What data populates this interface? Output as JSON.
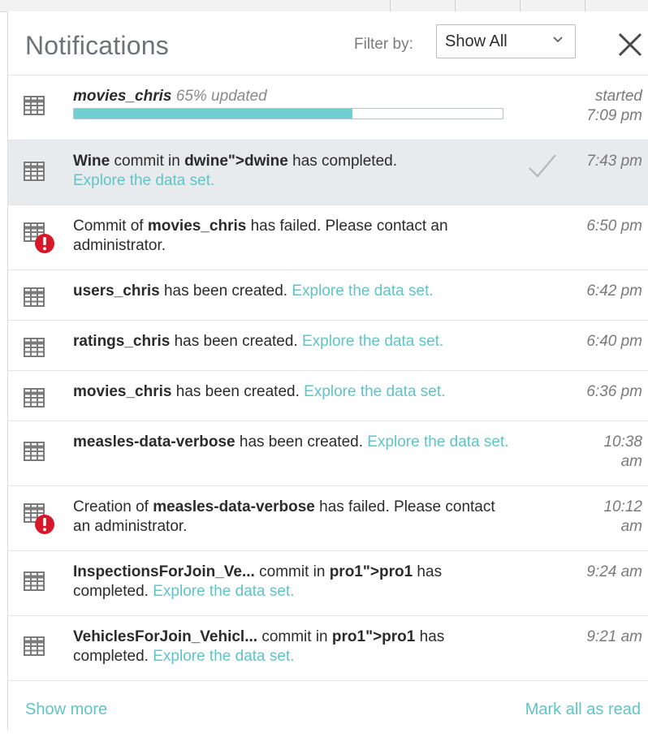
{
  "header": {
    "title": "Notifications",
    "filter_label": "Filter by:",
    "filter_value": "Show All"
  },
  "colors": {
    "accent_link": "#5fc4c8",
    "progress_fill": "#6fcfd1",
    "error": "#d7182a",
    "highlight_row": "#e8ebed"
  },
  "notifications": [
    {
      "type": "progress",
      "icon": "table-icon",
      "name": "movies_chris",
      "status": "65% updated",
      "progress": 0.65,
      "time_line1": "started",
      "time_line2": "7:09 pm"
    },
    {
      "type": "success",
      "icon": "table-icon",
      "name": "Wine",
      "mid": " commit in ",
      "target": "dwine\">dwine",
      "tail": " has completed.",
      "link": "Explore the data set.",
      "time": "7:43 pm",
      "read_indicator": "checkmark-icon"
    },
    {
      "type": "error",
      "icon": "table-error-icon",
      "pre": "Commit of ",
      "name": "movies_chris",
      "tail": " has failed. Please contact an administrator.",
      "time": "6:50 pm"
    },
    {
      "type": "created",
      "icon": "table-icon",
      "name": "users_chris",
      "tail": " has been created. ",
      "link": "Explore the data set.",
      "time": "6:42 pm"
    },
    {
      "type": "created",
      "icon": "table-icon",
      "name": "ratings_chris",
      "tail": " has been created. ",
      "link": "Explore the data set.",
      "time": "6:40 pm"
    },
    {
      "type": "created",
      "icon": "table-icon",
      "name": "movies_chris",
      "tail": " has been created. ",
      "link": "Explore the data set.",
      "time": "6:36 pm"
    },
    {
      "type": "created",
      "icon": "table-icon",
      "name": "measles-data-verbose",
      "tail": " has been created. ",
      "link": "Explore the data set.",
      "time_line1": "10:38",
      "time_line2": "am"
    },
    {
      "type": "error",
      "icon": "table-error-icon",
      "pre": "Creation of ",
      "name": "measles-data-verbose",
      "tail": " has failed. Please contact an administrator.",
      "time_line1": "10:12",
      "time_line2": "am"
    },
    {
      "type": "commit",
      "icon": "table-icon",
      "name": "InspectionsForJoin_Ve...",
      "mid": "  commit in ",
      "target": "pro1\">pro1",
      "tail": " has completed. ",
      "link": "Explore the data set.",
      "time": "9:24 am"
    },
    {
      "type": "commit",
      "icon": "table-icon",
      "name": "VehiclesForJoin_Vehicl...",
      "mid": " commit in ",
      "target": "pro1\">pro1",
      "tail": " has completed. ",
      "link": "Explore the data set.",
      "time": "9:21 am"
    }
  ],
  "footer": {
    "show_more": "Show more",
    "mark_all_read": "Mark all as read"
  }
}
